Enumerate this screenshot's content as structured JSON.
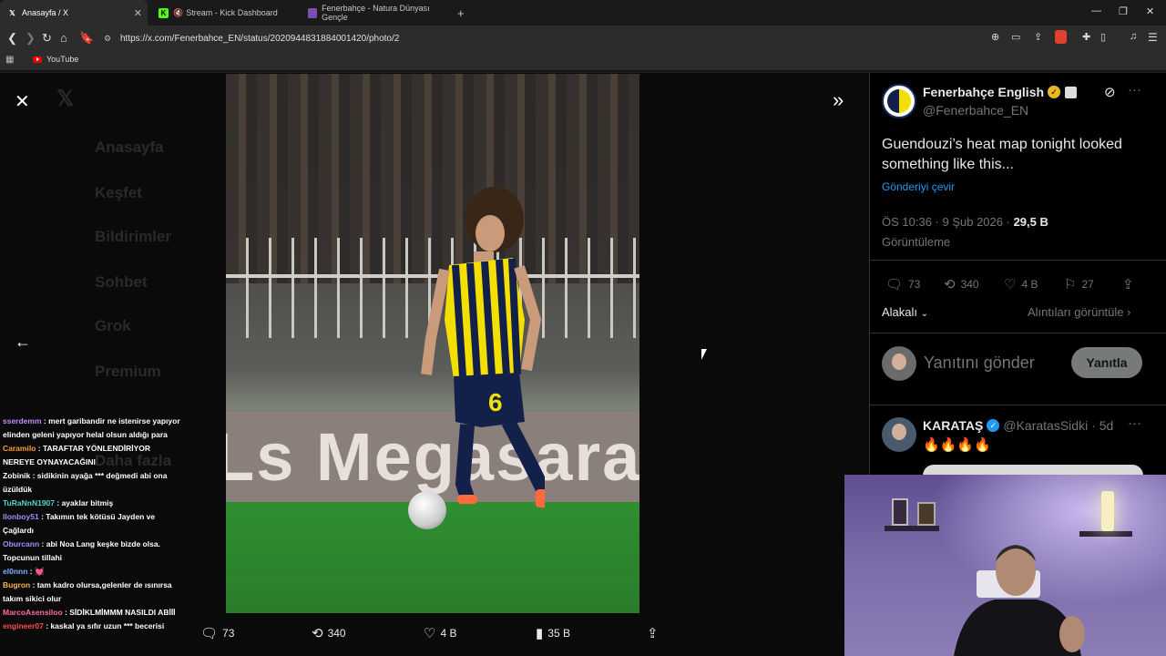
{
  "browser": {
    "tabs": [
      {
        "label": "Anasayfa / X",
        "icon": "x-logo-icon",
        "active": true
      },
      {
        "label": "Stream - Kick Dashboard",
        "icon": "kick-logo-icon",
        "active": false
      },
      {
        "label": "Fenerbahçe - Natura Dünyası Gençle",
        "icon": "web-page-icon",
        "active": false
      }
    ],
    "url": "https://x.com/Fenerbahce_EN/status/2020944831884001420/photo/2",
    "bookmarks": [
      {
        "label": "YouTube",
        "icon": "youtube-icon"
      }
    ]
  },
  "background_nav": {
    "items": [
      "Anasayfa",
      "Keşfet",
      "Bildirimler",
      "Sohbet",
      "Grok",
      "Premium",
      "Daha fazla"
    ]
  },
  "photo_viewer": {
    "board_text": "Megasara",
    "player_number": "6",
    "actions": {
      "replies": "73",
      "reposts": "340",
      "likes": "4 B",
      "views": "35 B"
    }
  },
  "chat": [
    {
      "user": "sserdemm",
      "color": "#c58cff",
      "text": ": mert garibandir ne istenirse yapıyor elinden geleni yapıyor helal olsun aldığı para"
    },
    {
      "user": "Caramilo",
      "color": "#ff9b2f",
      "text": ": TARAFTAR YÖNLENDİRİYOR NEREYE OYNAYACAĞINI"
    },
    {
      "user": "Zobinik",
      "color": "#ffffff",
      "text": ": sidikinin ayağa *** değmedi abi ona üzüldük"
    },
    {
      "user": "TuRaNnN1907",
      "color": "#4fd6c8",
      "text": ": ayaklar bitmiş"
    },
    {
      "user": "llonboy51",
      "color": "#a58bff",
      "text": ": Takımın tek kötüsü Jayden ve Çağlardı"
    },
    {
      "user": "Oburcann",
      "color": "#a58bff",
      "text": ": abi Noa Lang keşke bizde olsa. Topcunun tillahi"
    },
    {
      "user": "el0nnn",
      "color": "#7fb2ff",
      "text": ": 💓"
    },
    {
      "user": "Bugron",
      "color": "#ffb347",
      "text": ": tam kadro olursa,gelenler de ısınırsa takım sikici olur"
    },
    {
      "user": "MarcoAsensiloo",
      "color": "#ff6e9c",
      "text": ": SİDİKLMİMMM NASILDI ABİİİ"
    },
    {
      "user": "engineer07",
      "color": "#ff4d4d",
      "text": ": kaskal ya sıfır uzun *** becerisi"
    }
  ],
  "tweet": {
    "display_name": "Fenerbahçe English",
    "handle": "@Fenerbahce_EN",
    "text": "Guendouzi’s heat map tonight looked something like this...",
    "translate": "Gönderiyi çevir",
    "time": "ÖS 10:36 · 9 Şub 2026 ·",
    "views": "29,5 B",
    "views_label": "Görüntüleme",
    "stats": {
      "replies": "73",
      "reposts": "340",
      "likes": "4 B",
      "bookmarks": "27"
    },
    "sort_label": "Alakalı",
    "quotes_label": "Alıntıları görüntüle",
    "reply_placeholder": "Yanıtını gönder",
    "reply_button": "Yanıtla"
  },
  "reply": {
    "display_name": "KARATAŞ",
    "handle": "@KaratasSidki",
    "age": "· 5d",
    "text": "🔥🔥🔥🔥"
  },
  "colors": {
    "accent": "#1d9bf0",
    "verified_gold": "#e8b923",
    "verified_blue": "#1d9bf0"
  }
}
